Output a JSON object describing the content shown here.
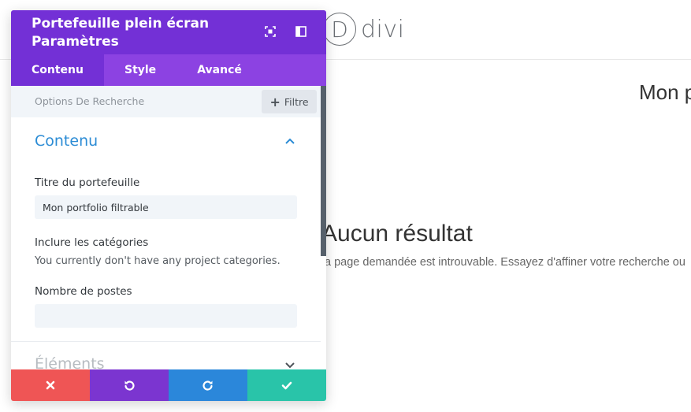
{
  "background": {
    "logo_letter": "D",
    "logo_text": "divi",
    "page_title": "Mon p",
    "no_result_title": "Aucun résultat",
    "no_result_message": "a page demandée est introuvable. Essayez d'affiner votre recherche ou"
  },
  "modal": {
    "title_line1": "Portefeuille plein écran",
    "title_line2": "Paramètres",
    "header_icons": [
      "fullscreen-icon",
      "sidebar-layout-icon"
    ],
    "tabs": [
      {
        "label": "Contenu",
        "active": true
      },
      {
        "label": "Style",
        "active": false
      },
      {
        "label": "Avancé",
        "active": false
      }
    ],
    "toolbar": {
      "search_options_label": "Options De Recherche",
      "filter_label": "Filtre"
    },
    "sections": {
      "content": {
        "title": "Contenu",
        "portfolio_title_label": "Titre du portefeuille",
        "portfolio_title_value": "Mon portfolio filtrable",
        "include_categories_label": "Inclure les catégories",
        "include_categories_note": "You currently don't have any project categories.",
        "post_count_label": "Nombre de postes",
        "post_count_value": ""
      },
      "elements": {
        "title": "Éléments"
      }
    },
    "footer": {
      "buttons": [
        {
          "name": "discard",
          "icon": "close-icon",
          "color": "#ef5555"
        },
        {
          "name": "undo",
          "icon": "undo-icon",
          "color": "#7b35d0"
        },
        {
          "name": "redo",
          "icon": "redo-icon",
          "color": "#2b87da"
        },
        {
          "name": "save",
          "icon": "check-icon",
          "color": "#29c4a9"
        }
      ]
    }
  },
  "colors": {
    "header_purple": "#7330d6",
    "tabs_purple": "#8c42e2",
    "accent_blue": "#2c8cd5"
  }
}
